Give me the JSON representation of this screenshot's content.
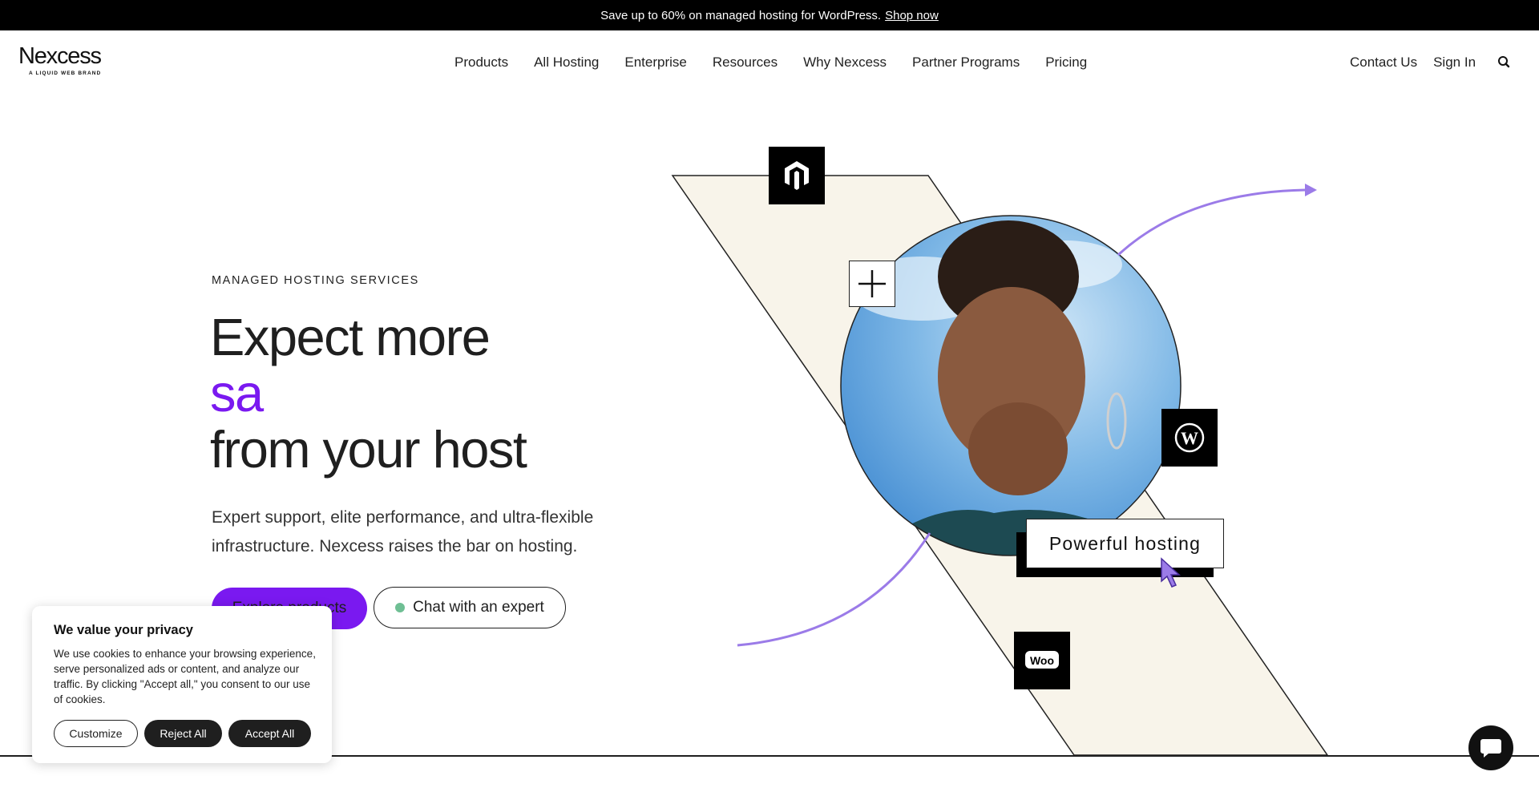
{
  "promo": {
    "text": "Save up to 60% on managed hosting for WordPress.",
    "link": "Shop now"
  },
  "header": {
    "logo_word": "Nexcess",
    "logo_tag": "A LIQUID WEB BRAND",
    "nav": [
      "Products",
      "All Hosting",
      "Enterprise",
      "Resources",
      "Why Nexcess",
      "Partner Programs",
      "Pricing"
    ],
    "contact": "Contact Us",
    "signin": "Sign In",
    "search_icon": "search-icon"
  },
  "hero": {
    "eyebrow": "MANAGED HOSTING SERVICES",
    "line1": "Expect more",
    "line2": "sa",
    "line3": "from your host",
    "sub": "Expert support, elite performance, and ultra-flexible infrastructure. Nexcess raises the bar on hosting.",
    "primary_btn": "Explore products",
    "chat_btn": "Chat with an expert",
    "badge": "Powerful hosting"
  },
  "cookie": {
    "title": "We value your privacy",
    "body": "We use cookies to enhance your browsing experience, serve personalized ads or content, and analyze our traffic. By clicking \"Accept all,\" you consent to our use of cookies.",
    "customize": "Customize",
    "reject": "Reject All",
    "accept": "Accept All"
  },
  "colors": {
    "accent": "#7a19f0",
    "arrow": "#9b7be8",
    "cream": "#f8f4ea",
    "status_dot": "#6fbf94"
  },
  "icons": [
    "magento-icon",
    "plus-icon",
    "wordpress-icon",
    "woo-icon",
    "cursor-icon",
    "arrow-icon",
    "chat-bubble-icon"
  ]
}
